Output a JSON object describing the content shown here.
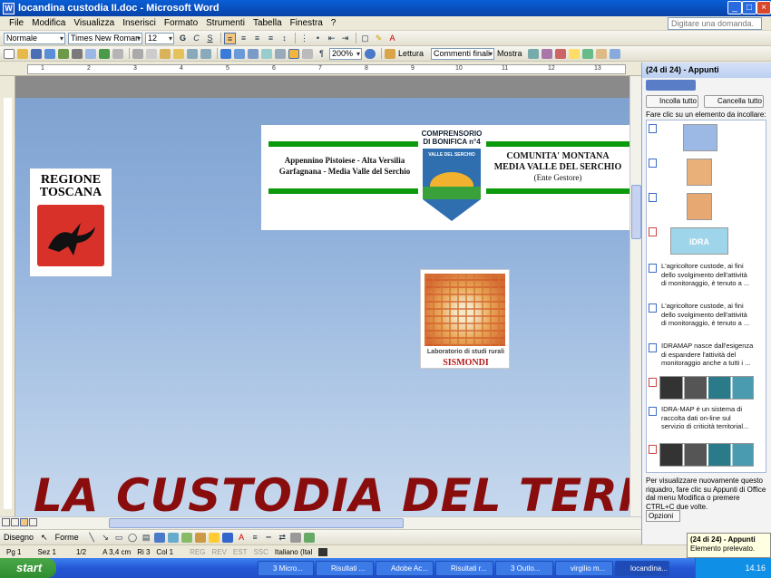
{
  "window": {
    "title": "locandina custodia II.doc - Microsoft Word",
    "min": "_",
    "max": "□",
    "close": "×"
  },
  "menu": [
    "File",
    "Modifica",
    "Visualizza",
    "Inserisci",
    "Formato",
    "Strumenti",
    "Tabella",
    "Finestra",
    "?"
  ],
  "help_placeholder": "Digitare una domanda.",
  "format_toolbar": {
    "style": "Normale",
    "font": "Times New Roman",
    "size": "12",
    "bold": "G",
    "italic": "C",
    "underline": "S"
  },
  "standard_toolbar": {
    "zoom": "200%",
    "read": "Lettura",
    "track": "Commenti finali",
    "show": "Mostra"
  },
  "ruler_ticks": [
    "1",
    "2",
    "3",
    "4",
    "5",
    "6",
    "7",
    "8",
    "9",
    "10",
    "11",
    "12",
    "13"
  ],
  "document": {
    "banner_left": "Appennino Pistoiese - Alta Versilia Garfagnana - Media Valle del Serchio",
    "banner_center_top": "COMPRENSORIO DI BONIFICA n°4",
    "banner_center_badge": "VALLE DEL SERCHIO",
    "banner_right_1": "COMUNITA' MONTANA",
    "banner_right_2": "MEDIA VALLE DEL SERCHIO",
    "banner_right_3": "(Ente Gestore)",
    "regione_1": "REGIONE",
    "regione_2": "TOSCANA",
    "sismondi_1": "Laboratorio di studi rurali",
    "sismondi_2": "SISMONDI",
    "big_title": "LA CUSTODIA DEL TERR"
  },
  "clipboard": {
    "header": "(24 di 24) - Appunti",
    "paste_all": "Incolla tutto",
    "clear_all": "Cancella tutto",
    "help": "Fare clic su un elemento da incollare:",
    "idra": "IDRA",
    "items": [
      "L'agricoltore custode, ai fini dello svolgimento dell'attività di monitoraggio, è tenuto a ...",
      "L'agricoltore custode, ai fini dello svolgimento dell'attività di monitoraggio, è tenuto a ...",
      "IDRAMAP nasce dall'esigenza di espandere l'attività del monitoraggio anche a tutti i ...",
      "IDRA-MAP è un sistema di raccolta dati on-line sul servizio di criticità territorial..."
    ],
    "footer": "Per visualizzare nuovamente questo riquadro, fare clic su Appunti di Office dal menu Modifica o premere CTRL+C due volte.",
    "options": "Opzioni"
  },
  "drawbar": {
    "draw": "Disegno",
    "shapes": "Forme"
  },
  "status": {
    "page": "Pg 1",
    "sec": "Sez 1",
    "pages": "1/2",
    "at": "A 3,4 cm",
    "line": "Ri 3",
    "col": "Col 1",
    "rec": "REG",
    "rev": "REV",
    "ext": "EST",
    "ovr": "SSC",
    "lang": "Italiano (Ital"
  },
  "notify": {
    "title": "(24 di 24) - Appunti",
    "text": "Elemento prelevato."
  },
  "taskbar": {
    "start": "start",
    "tasks": [
      "3 Micro...",
      "Risultati ...",
      "Adobe Ac...",
      "Risultati r...",
      "3 Outlo...",
      "virgilio m...",
      "locandina..."
    ],
    "clock": "14.16"
  }
}
